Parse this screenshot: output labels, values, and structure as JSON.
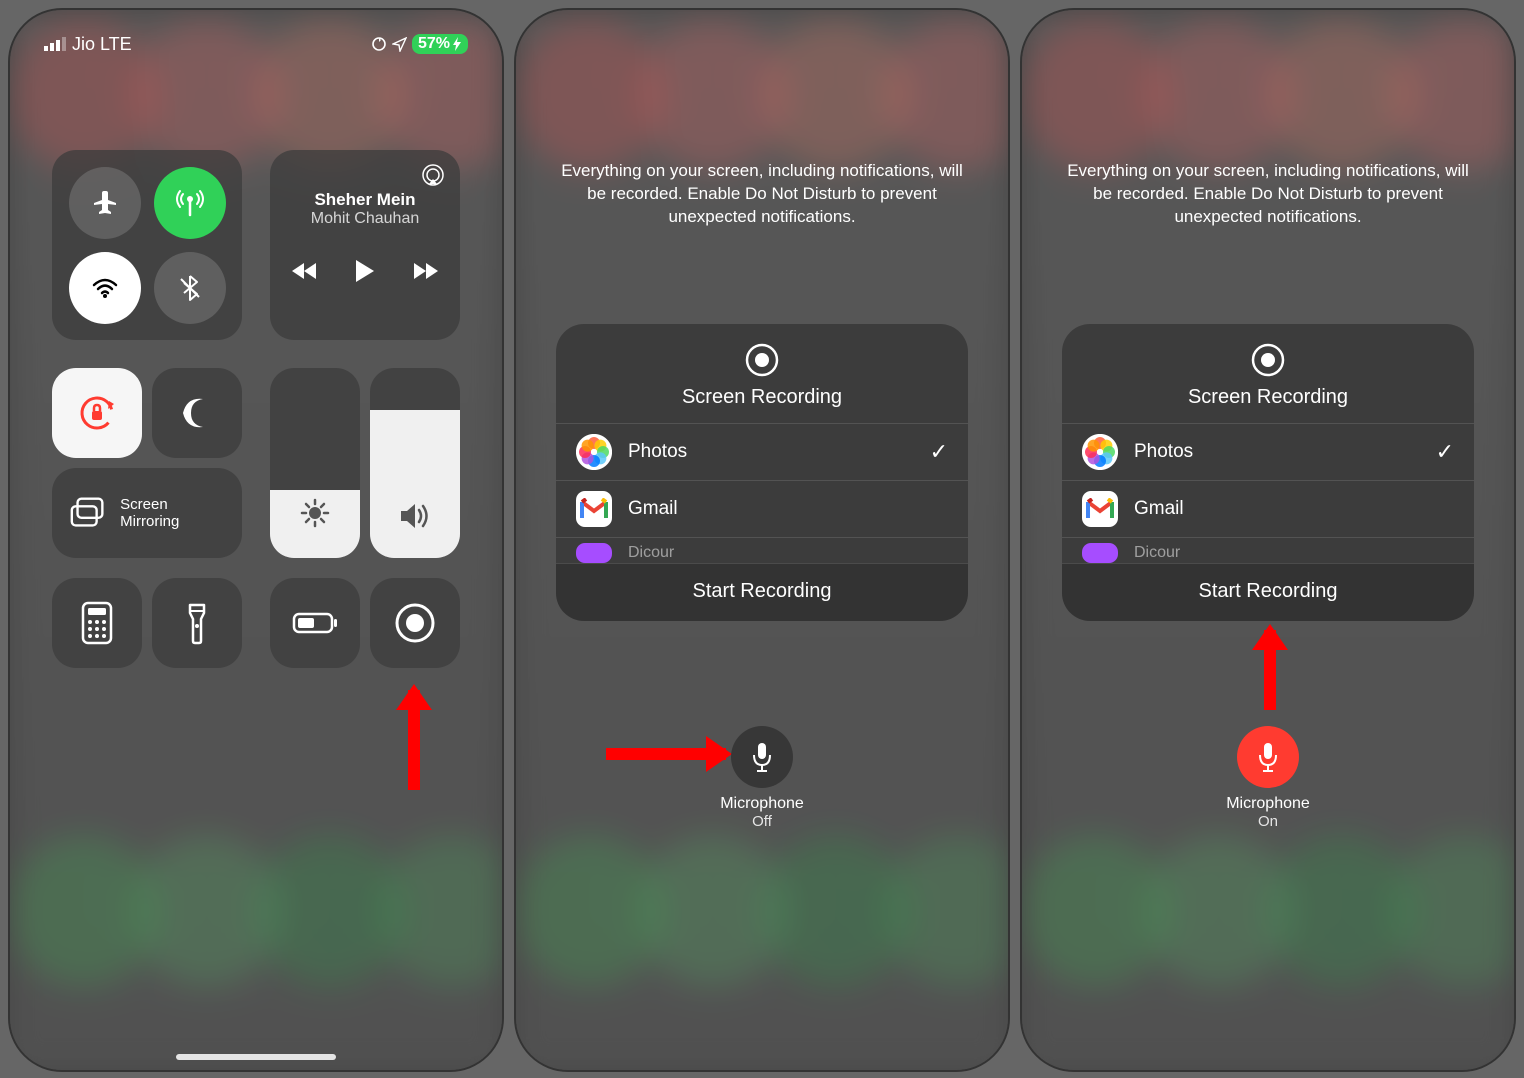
{
  "status": {
    "carrier": "Jio LTE",
    "battery_pct": "57%"
  },
  "media": {
    "title": "Sheher Mein",
    "artist": "Mohit Chauhan"
  },
  "mirror": {
    "label": "Screen Mirroring"
  },
  "notice_text": "Everything on your screen, including notifications, will be recorded. Enable Do Not Disturb to prevent unexpected notifications.",
  "sheet": {
    "title": "Screen Recording",
    "apps": {
      "photos": "Photos",
      "gmail": "Gmail",
      "picsew": "Dicour"
    },
    "start": "Start Recording"
  },
  "mic": {
    "label": "Microphone",
    "off": "Off",
    "on": "On"
  }
}
